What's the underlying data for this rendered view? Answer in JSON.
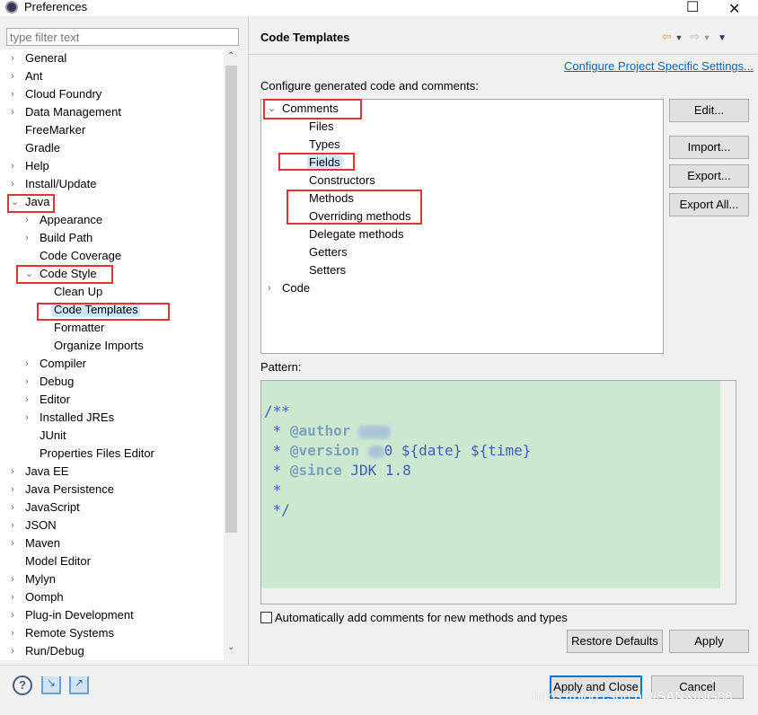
{
  "window": {
    "title": "Preferences",
    "minimize": "—",
    "maximize": "☐",
    "close": "✕"
  },
  "filter": {
    "placeholder": "type filter text"
  },
  "left_tree": [
    {
      "label": "General",
      "level": 0,
      "arrow": "›"
    },
    {
      "label": "Ant",
      "level": 0,
      "arrow": "›"
    },
    {
      "label": "Cloud Foundry",
      "level": 0,
      "arrow": "›"
    },
    {
      "label": "Data Management",
      "level": 0,
      "arrow": "›"
    },
    {
      "label": "FreeMarker",
      "level": 0,
      "arrow": ""
    },
    {
      "label": "Gradle",
      "level": 0,
      "arrow": ""
    },
    {
      "label": "Help",
      "level": 0,
      "arrow": "›"
    },
    {
      "label": "Install/Update",
      "level": 0,
      "arrow": "›"
    },
    {
      "label": "Java",
      "level": 0,
      "arrow": "⌄"
    },
    {
      "label": "Appearance",
      "level": 1,
      "arrow": "›"
    },
    {
      "label": "Build Path",
      "level": 1,
      "arrow": "›"
    },
    {
      "label": "Code Coverage",
      "level": 1,
      "arrow": ""
    },
    {
      "label": "Code Style",
      "level": 1,
      "arrow": "⌄"
    },
    {
      "label": "Clean Up",
      "level": 2,
      "arrow": ""
    },
    {
      "label": "Code Templates",
      "level": 2,
      "arrow": "",
      "selected": true
    },
    {
      "label": "Formatter",
      "level": 2,
      "arrow": ""
    },
    {
      "label": "Organize Imports",
      "level": 2,
      "arrow": ""
    },
    {
      "label": "Compiler",
      "level": 1,
      "arrow": "›"
    },
    {
      "label": "Debug",
      "level": 1,
      "arrow": "›"
    },
    {
      "label": "Editor",
      "level": 1,
      "arrow": "›"
    },
    {
      "label": "Installed JREs",
      "level": 1,
      "arrow": "›"
    },
    {
      "label": "JUnit",
      "level": 1,
      "arrow": ""
    },
    {
      "label": "Properties Files Editor",
      "level": 1,
      "arrow": ""
    },
    {
      "label": "Java EE",
      "level": 0,
      "arrow": "›"
    },
    {
      "label": "Java Persistence",
      "level": 0,
      "arrow": "›"
    },
    {
      "label": "JavaScript",
      "level": 0,
      "arrow": "›"
    },
    {
      "label": "JSON",
      "level": 0,
      "arrow": "›"
    },
    {
      "label": "Maven",
      "level": 0,
      "arrow": "›"
    },
    {
      "label": "Model Editor",
      "level": 0,
      "arrow": ""
    },
    {
      "label": "Mylyn",
      "level": 0,
      "arrow": "›"
    },
    {
      "label": "Oomph",
      "level": 0,
      "arrow": "›"
    },
    {
      "label": "Plug-in Development",
      "level": 0,
      "arrow": "›"
    },
    {
      "label": "Remote Systems",
      "level": 0,
      "arrow": "›"
    },
    {
      "label": "Run/Debug",
      "level": 0,
      "arrow": "›"
    }
  ],
  "page": {
    "title": "Code Templates",
    "link": "Configure Project Specific Settings...",
    "configure_label": "Configure generated code and comments:",
    "pattern_label": "Pattern:"
  },
  "template_tree": [
    {
      "label": "Comments",
      "level": 0,
      "arrow": "⌄"
    },
    {
      "label": "Files",
      "level": 1
    },
    {
      "label": "Types",
      "level": 1
    },
    {
      "label": "Fields",
      "level": 1,
      "selected": true
    },
    {
      "label": "Constructors",
      "level": 1
    },
    {
      "label": "Methods",
      "level": 1
    },
    {
      "label": "Overriding methods",
      "level": 1
    },
    {
      "label": "Delegate methods",
      "level": 1
    },
    {
      "label": "Getters",
      "level": 1
    },
    {
      "label": "Setters",
      "level": 1
    },
    {
      "label": "Code",
      "level": 0,
      "arrow": "›"
    }
  ],
  "buttons": {
    "edit": "Edit...",
    "import": "Import...",
    "export": "Export...",
    "export_all": "Export All...",
    "restore": "Restore Defaults",
    "apply": "Apply",
    "apply_close": "Apply and Close",
    "cancel": "Cancel"
  },
  "pattern": {
    "l1": "/**",
    "star": " * ",
    "author_tag": "@author",
    "version_tag": "@version",
    "version_rest": "0 ${date} ${time}",
    "since_tag": "@since",
    "since_rest": " JDK 1.8",
    "l5": " *",
    "l6": " */"
  },
  "checkbox": {
    "label": "Automatically add comments for new methods and types",
    "checked": false
  },
  "watermark": "https://blog.csdn.net/SANXING88",
  "colors": {
    "highlight": "#e53333",
    "pattern_bg": "#cce8cf",
    "link": "#0066cc",
    "default_button": "#0078d7"
  }
}
